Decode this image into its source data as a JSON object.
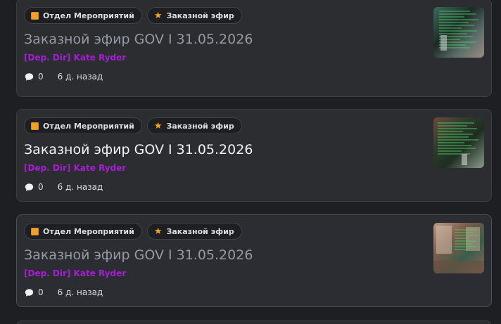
{
  "posts": [
    {
      "tags": [
        {
          "label": "Отдел Мероприятий",
          "icon": "orange-square-icon"
        },
        {
          "label": "Заказной эфир",
          "icon": "star-icon"
        }
      ],
      "title": "Заказной эфир GOV I 31.05.2026",
      "author": "[Dep. Dir] Kate Ryder",
      "comments": "0",
      "time": "6 д. назад"
    },
    {
      "tags": [
        {
          "label": "Отдел Мероприятий",
          "icon": "orange-square-icon"
        },
        {
          "label": "Заказной эфир",
          "icon": "star-icon"
        }
      ],
      "title": "Заказной эфир GOV I 31.05.2026",
      "author": "[Dep. Dir] Kate Ryder",
      "comments": "0",
      "time": "6 д. назад"
    },
    {
      "tags": [
        {
          "label": "Отдел Мероприятий",
          "icon": "orange-square-icon"
        },
        {
          "label": "Заказной эфир",
          "icon": "star-icon"
        }
      ],
      "title": "Заказной эфир GOV I 31.05.2026",
      "author": "[Dep. Dir] Kate Ryder",
      "comments": "0",
      "time": "6 д. назад"
    }
  ],
  "colors": {
    "background": "#1e1f22",
    "card": "#2b2d31",
    "author": "#a51fd1",
    "title_read": "#949ba4",
    "title_unread": "#f2f3f5",
    "tag_square": "#f0a030",
    "star": "#f5a623"
  }
}
